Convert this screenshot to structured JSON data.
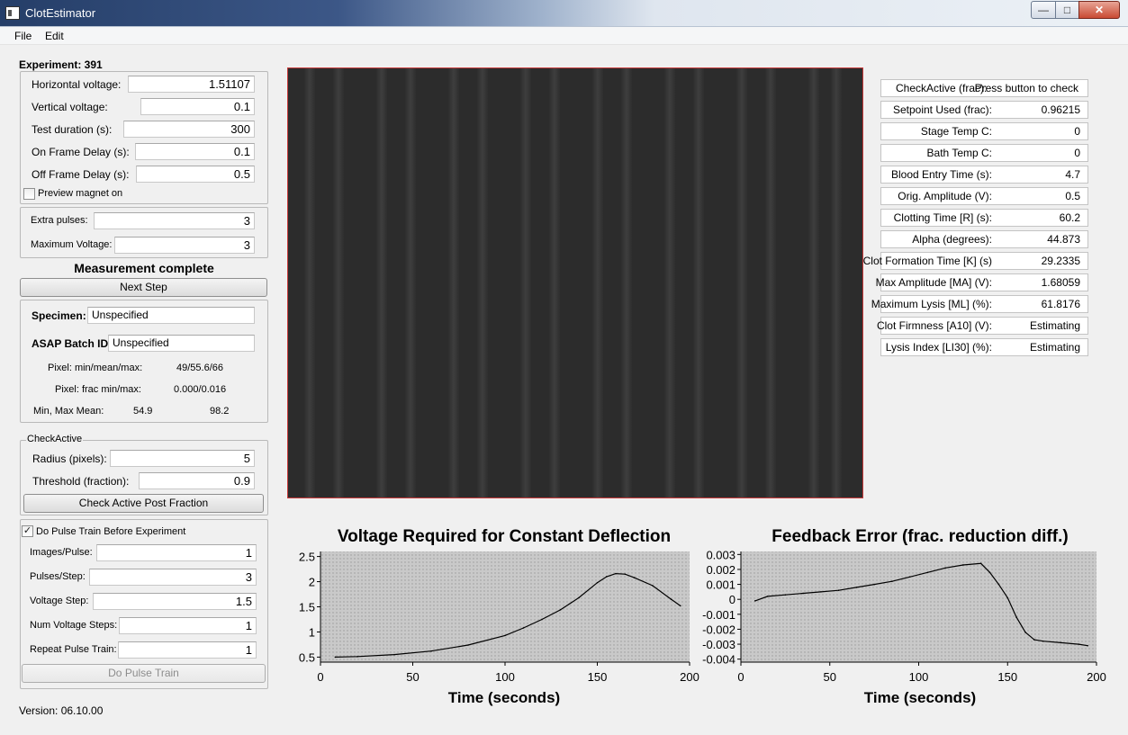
{
  "window": {
    "title": "ClotEstimator",
    "min_glyph": "—",
    "max_glyph": "□",
    "close_glyph": "✕"
  },
  "menu": {
    "file": "File",
    "edit": "Edit"
  },
  "experiment": {
    "title": "Experiment: 391",
    "horizontal_voltage_label": "Horizontal voltage:",
    "horizontal_voltage": "1.51107",
    "vertical_voltage_label": "Vertical voltage:",
    "vertical_voltage": "0.1",
    "test_duration_label": "Test duration (s):",
    "test_duration": "300",
    "on_frame_delay_label": "On Frame Delay (s):",
    "on_frame_delay": "0.1",
    "off_frame_delay_label": "Off Frame Delay (s):",
    "off_frame_delay": "0.5",
    "preview_magnet_label": "Preview magnet on",
    "preview_magnet_checked": false
  },
  "pulses": {
    "extra_pulses_label": "Extra pulses:",
    "extra_pulses": "3",
    "max_voltage_label": "Maximum Voltage:",
    "max_voltage": "3"
  },
  "status": {
    "text": "Measurement complete",
    "next_step_label": "Next Step"
  },
  "specimen": {
    "specimen_label": "Specimen:",
    "specimen_value": "Unspecified",
    "batch_label": "ASAP Batch ID",
    "batch_value": "Unspecified",
    "pixel_minmeanmax_label": "Pixel: min/mean/max:",
    "pixel_minmeanmax": "49/55.6/66",
    "pixel_frac_label": "Pixel: frac min/max:",
    "pixel_frac": "0.000/0.016",
    "minmax_mean_label": "Min, Max Mean:",
    "min_mean": "54.9",
    "max_mean": "98.2"
  },
  "check_active": {
    "group_label": "CheckActive",
    "radius_label": "Radius (pixels):",
    "radius": "5",
    "threshold_label": "Threshold (fraction):",
    "threshold": "0.9",
    "button_label": "Check Active Post Fraction"
  },
  "pulse_train": {
    "enable_label": "Do Pulse Train Before Experiment",
    "enable_checked": true,
    "check_glyph": "✓",
    "images_label": "Images/Pulse:",
    "images": "1",
    "pulses_label": "Pulses/Step:",
    "pulses": "3",
    "voltage_step_label": "Voltage Step:",
    "voltage_step": "1.5",
    "num_steps_label": "Num Voltage Steps:",
    "num_steps": "1",
    "repeat_label": "Repeat Pulse Train:",
    "repeat": "1",
    "button_label": "Do Pulse Train"
  },
  "version": "Version: 06.10.00",
  "results": [
    {
      "label": "CheckActive (frac):",
      "value": "Press button to check"
    },
    {
      "label": "Setpoint Used (frac):",
      "value": "0.96215"
    },
    {
      "label": "Stage Temp C:",
      "value": "0"
    },
    {
      "label": "Bath Temp C:",
      "value": "0"
    },
    {
      "label": "Blood Entry Time (s):",
      "value": "4.7"
    },
    {
      "label": "Orig. Amplitude (V):",
      "value": "0.5"
    },
    {
      "label": "Clotting Time [R] (s):",
      "value": "60.2"
    },
    {
      "label": "Alpha (degrees):",
      "value": "44.873"
    },
    {
      "label": "Clot Formation Time [K] (s)",
      "value": "29.2335"
    },
    {
      "label": "Max Amplitude [MA] (V):",
      "value": "1.68059"
    },
    {
      "label": "Maximum Lysis [ML] (%):",
      "value": "61.8176"
    },
    {
      "label": "Clot Firmness [A10] (V):",
      "value": "Estimating"
    },
    {
      "label": "Lysis Index [LI30] (%):",
      "value": "Estimating"
    }
  ],
  "chart_data": [
    {
      "type": "line",
      "title": "Voltage Required for Constant Deflection",
      "xlabel": "Time (seconds)",
      "ylabel": "",
      "xlim": [
        0,
        200
      ],
      "ylim": [
        0.4,
        2.6
      ],
      "xticks": [
        0,
        50,
        100,
        150,
        200
      ],
      "yticks": [
        0.5,
        1,
        1.5,
        2,
        2.5
      ],
      "grid": true,
      "x": [
        8,
        20,
        40,
        60,
        80,
        100,
        110,
        120,
        130,
        140,
        150,
        155,
        160,
        165,
        170,
        180,
        190,
        195
      ],
      "y": [
        0.5,
        0.51,
        0.55,
        0.62,
        0.74,
        0.93,
        1.08,
        1.25,
        1.44,
        1.68,
        1.98,
        2.1,
        2.16,
        2.15,
        2.08,
        1.92,
        1.65,
        1.52
      ]
    },
    {
      "type": "line",
      "title": "Feedback Error (frac. reduction diff.)",
      "xlabel": "Time (seconds)",
      "ylabel": "",
      "xlim": [
        0,
        200
      ],
      "ylim": [
        -0.0042,
        0.0032
      ],
      "xticks": [
        0,
        50,
        100,
        150,
        200
      ],
      "yticks": [
        0.003,
        0.002,
        0.001,
        0,
        -0.001,
        -0.002,
        -0.003,
        -0.004
      ],
      "grid": true,
      "x": [
        8,
        15,
        25,
        35,
        45,
        55,
        65,
        75,
        85,
        95,
        105,
        115,
        125,
        135,
        140,
        145,
        150,
        155,
        160,
        165,
        170,
        180,
        190,
        195
      ],
      "y": [
        -0.0001,
        0.0002,
        0.0003,
        0.0004,
        0.0005,
        0.0006,
        0.0008,
        0.001,
        0.0012,
        0.0015,
        0.0018,
        0.0021,
        0.0023,
        0.0024,
        0.0018,
        0.001,
        0.0001,
        -0.0012,
        -0.0022,
        -0.0027,
        -0.0028,
        -0.0029,
        -0.003,
        -0.0031
      ]
    }
  ],
  "colors": {
    "viewer_border": "#c83a3a",
    "viewer_bg": "#2c2c2c",
    "plot_bg": "#c9c9c9",
    "line": "#000000"
  }
}
